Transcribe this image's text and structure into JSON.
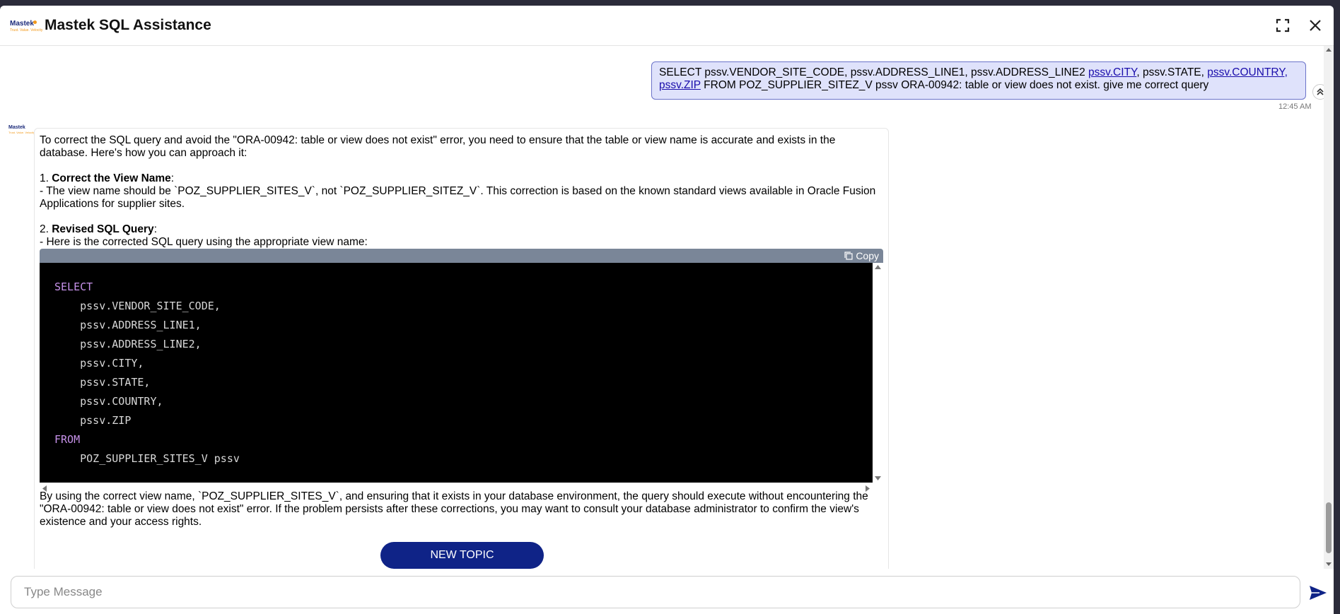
{
  "header": {
    "logo_text": "Mastek",
    "logo_tagline": "Trust. Value. Velocity",
    "title": "Mastek SQL Assistance"
  },
  "user_message": {
    "part1": "SELECT pssv.VENDOR_SITE_CODE, pssv.ADDRESS_LINE1, pssv.ADDRESS_LINE2 ",
    "link_city": "pssv.CITY",
    "part2": ", pssv.STATE, ",
    "link_country": "pssv.COUNTRY,",
    "link_zip": "pssv.ZIP",
    "part3": " FROM POZ_SUPPLIER_SITEZ_V pssv ORA-00942: table or view does not exist. give me correct query",
    "timestamp": "12:45 AM"
  },
  "bot_message": {
    "intro": "To correct the SQL query and avoid the \"ORA-00942: table or view does not exist\" error, you need to ensure that the table or view name is accurate and exists in the database. Here's how you can approach it:",
    "step1_num": "1. ",
    "step1_title": "Correct the View Name",
    "step1_colon": ":",
    "step1_text": "- The view name should be `POZ_SUPPLIER_SITES_V`, not `POZ_SUPPLIER_SITEZ_V`. This correction is based on the known standard views available in Oracle Fusion Applications for supplier sites.",
    "step2_num": "2. ",
    "step2_title": "Revised SQL Query",
    "step2_colon": ":",
    "step2_text": "- Here is the corrected SQL query using the appropriate view name:",
    "copy_label": "Copy",
    "code": {
      "l1": "SELECT",
      "l2": "    pssv.VENDOR_SITE_CODE,",
      "l3": "    pssv.ADDRESS_LINE1,",
      "l4": "    pssv.ADDRESS_LINE2,",
      "l5": "    pssv.CITY,",
      "l6": "    pssv.STATE,",
      "l7": "    pssv.COUNTRY,",
      "l8": "    pssv.ZIP",
      "l9": "FROM",
      "l10": "    POZ_SUPPLIER_SITES_V pssv"
    },
    "outro": "By using the correct view name, `POZ_SUPPLIER_SITES_V`, and ensuring that it exists in your database environment, the query should execute without encountering the \"ORA-00942: table or view does not exist\" error. If the problem persists after these corrections, you may want to consult your database administrator to confirm the view's existence and your access rights.",
    "new_topic_label": "NEW TOPIC"
  },
  "input": {
    "placeholder": "Type Message"
  },
  "colors": {
    "accent": "#0f2387",
    "user_bubble": "#dfe2fb",
    "keyword": "#c792ea"
  }
}
